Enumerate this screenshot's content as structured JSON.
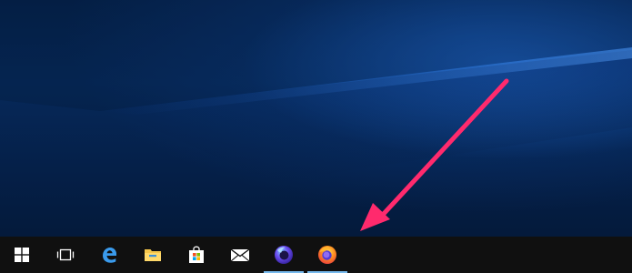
{
  "desktop": {
    "wallpaper": "windows-10-hero-blue",
    "colors": {
      "base": "#05214a",
      "glow": "#2f7fe0"
    }
  },
  "taskbar": {
    "background": "#101010",
    "running_indicator": "#76b9ed",
    "items": [
      {
        "name": "start-button",
        "icon": "windows-logo-icon",
        "running": false
      },
      {
        "name": "task-view-button",
        "icon": "task-view-icon",
        "running": false
      },
      {
        "name": "edge-button",
        "icon": "edge-icon",
        "running": false
      },
      {
        "name": "file-explorer-button",
        "icon": "folder-icon",
        "running": false
      },
      {
        "name": "store-button",
        "icon": "store-bag-icon",
        "running": false
      },
      {
        "name": "mail-button",
        "icon": "mail-icon",
        "running": false
      },
      {
        "name": "firefox-nightly-button",
        "icon": "firefox-nightly-icon",
        "running": true
      },
      {
        "name": "firefox-button",
        "icon": "firefox-icon",
        "running": true
      }
    ]
  },
  "annotation": {
    "type": "arrow",
    "color": "#ff2a6d",
    "points_to": "firefox-button"
  }
}
